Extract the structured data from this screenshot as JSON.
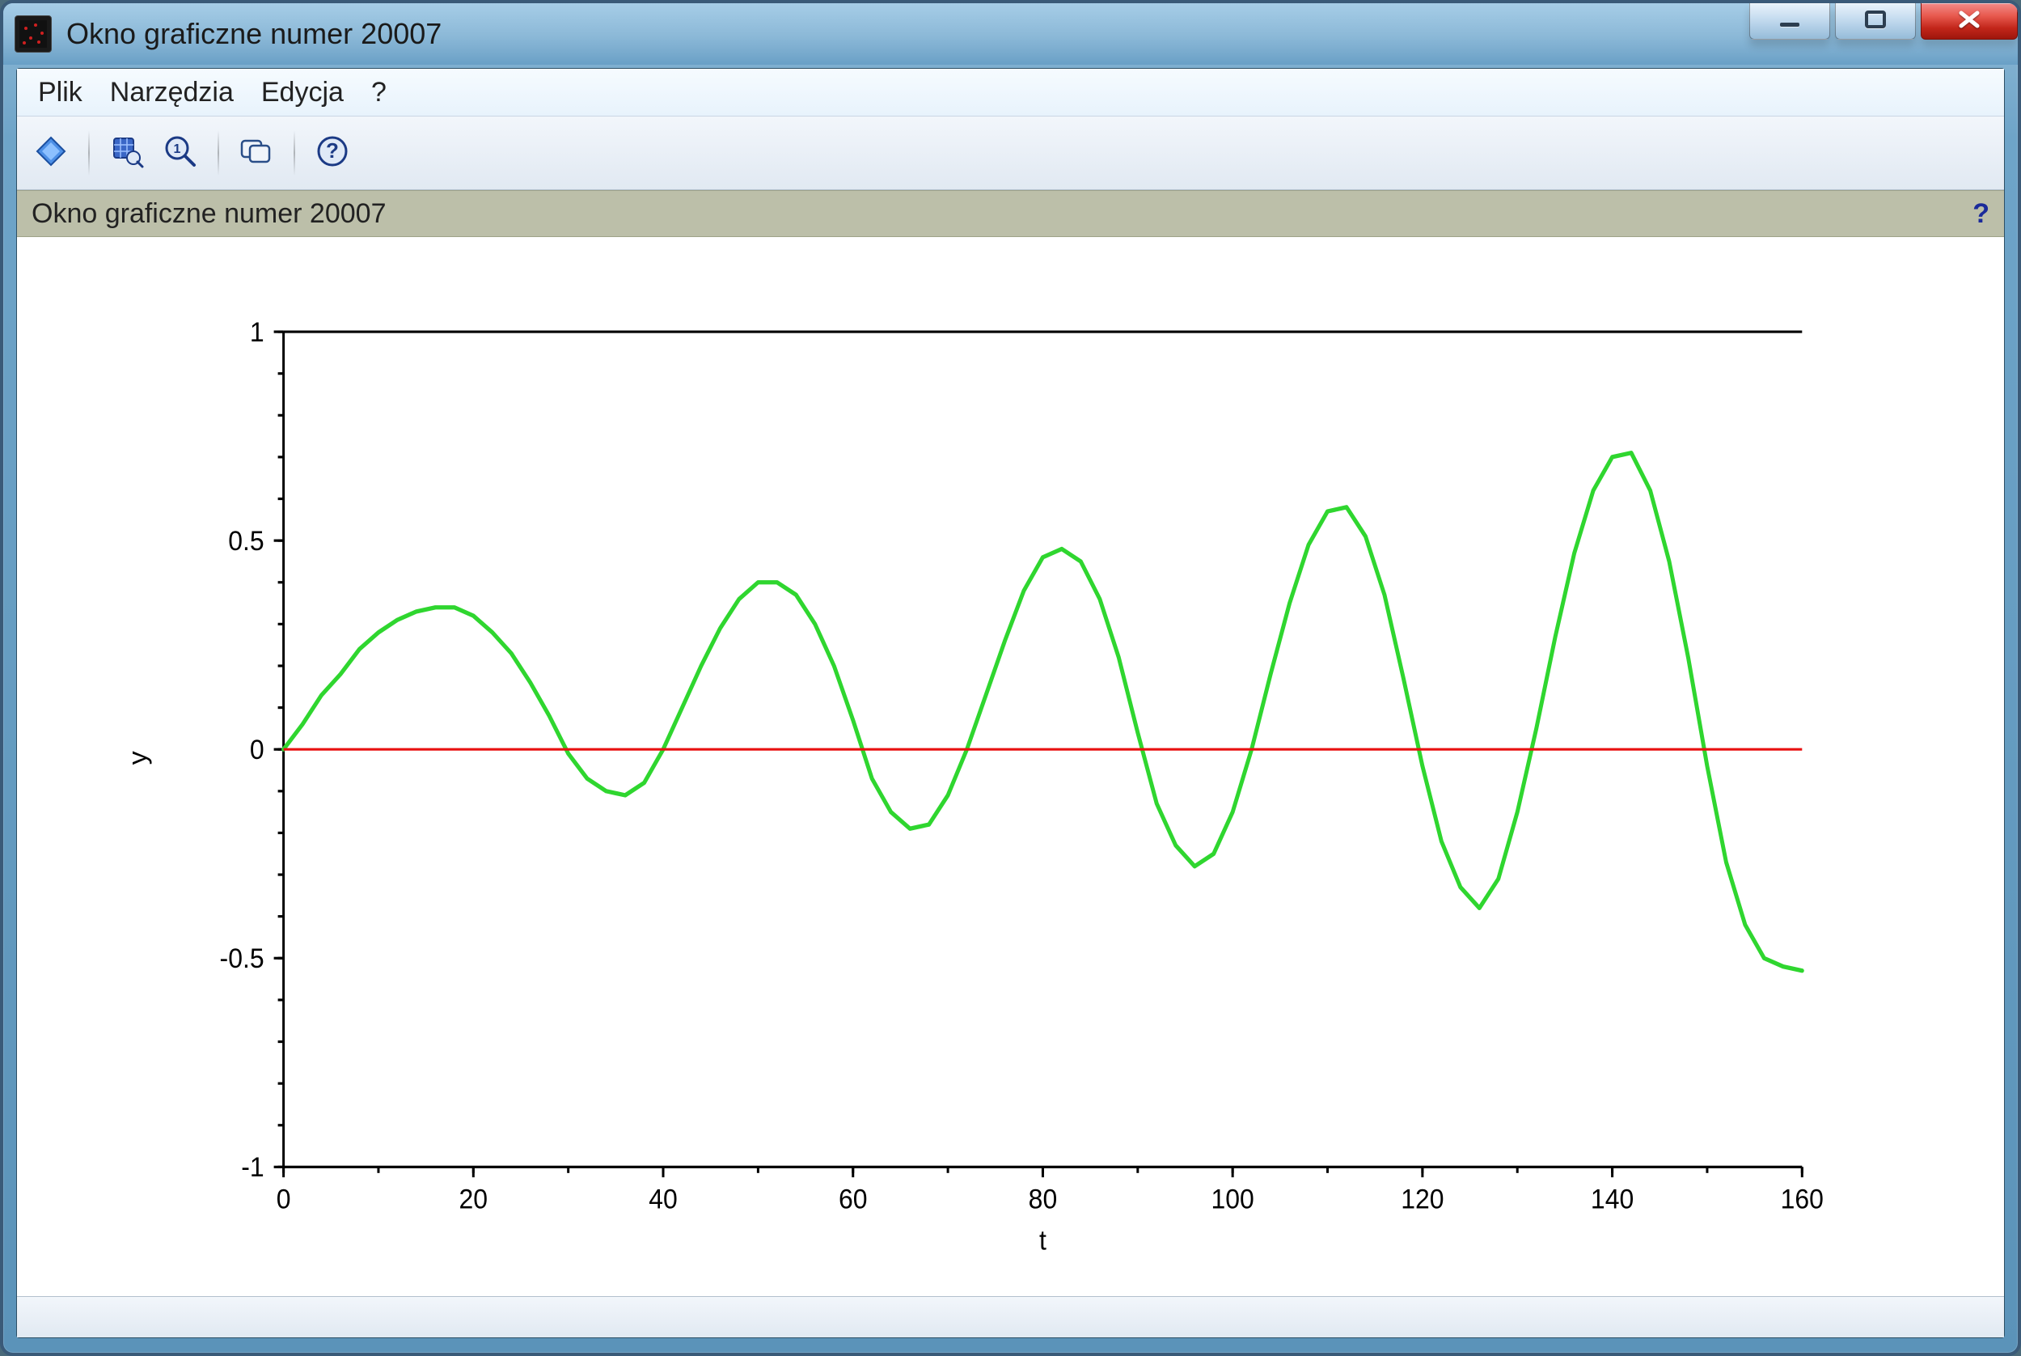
{
  "window": {
    "title": "Okno graficzne numer 20007"
  },
  "menu": {
    "items": [
      "Plik",
      "Narzędzia",
      "Edycja",
      "?"
    ]
  },
  "toolbar": {
    "rotate_label": "Rotate",
    "zoom_area_label": "Zoom area",
    "zoom_reset_label": "Reset zoom",
    "copy_label": "Copy",
    "help_label": "Help"
  },
  "infobar": {
    "text": "Okno graficzne numer 20007",
    "help_glyph": "?"
  },
  "chart_data": {
    "type": "line",
    "xlabel": "t",
    "ylabel": "y",
    "xlim": [
      0,
      160
    ],
    "ylim": [
      -1,
      1
    ],
    "xticks": [
      0,
      20,
      40,
      60,
      80,
      100,
      120,
      140,
      160
    ],
    "yticks": [
      -1,
      -0.5,
      0,
      0.5,
      1
    ],
    "series": [
      {
        "name": "green",
        "color": "#2fd62f",
        "x": [
          0,
          2,
          4,
          6,
          8,
          10,
          12,
          14,
          16,
          18,
          20,
          22,
          24,
          26,
          28,
          30,
          32,
          34,
          36,
          38,
          40,
          42,
          44,
          46,
          48,
          50,
          52,
          54,
          56,
          58,
          60,
          62,
          64,
          66,
          68,
          70,
          72,
          74,
          76,
          78,
          80,
          82,
          84,
          86,
          88,
          90,
          92,
          94,
          96,
          98,
          100,
          102,
          104,
          106,
          108,
          110,
          112,
          114,
          116,
          118,
          120,
          122,
          124,
          126,
          128,
          130,
          132,
          134,
          136,
          138,
          140,
          142,
          144,
          146,
          148,
          150,
          152,
          154,
          156,
          158,
          160
        ],
        "values": [
          0.0,
          0.06,
          0.13,
          0.18,
          0.24,
          0.28,
          0.31,
          0.33,
          0.34,
          0.34,
          0.32,
          0.28,
          0.23,
          0.16,
          0.08,
          -0.01,
          -0.07,
          -0.1,
          -0.11,
          -0.08,
          0.0,
          0.1,
          0.2,
          0.29,
          0.36,
          0.4,
          0.4,
          0.37,
          0.3,
          0.2,
          0.07,
          -0.07,
          -0.15,
          -0.19,
          -0.18,
          -0.11,
          0.0,
          0.13,
          0.26,
          0.38,
          0.46,
          0.48,
          0.45,
          0.36,
          0.22,
          0.04,
          -0.13,
          -0.23,
          -0.28,
          -0.25,
          -0.15,
          0.0,
          0.18,
          0.35,
          0.49,
          0.57,
          0.58,
          0.51,
          0.37,
          0.17,
          -0.04,
          -0.22,
          -0.33,
          -0.38,
          -0.31,
          -0.15,
          0.05,
          0.27,
          0.47,
          0.62,
          0.7,
          0.71,
          0.62,
          0.45,
          0.22,
          -0.04,
          -0.27,
          -0.42,
          -0.5,
          -0.52,
          -0.53
        ]
      },
      {
        "name": "red_zero_line",
        "color": "#e81010",
        "x": [
          0,
          160
        ],
        "values": [
          0,
          0
        ]
      },
      {
        "name": "black_top_line",
        "color": "#000000",
        "x": [
          0,
          160
        ],
        "values": [
          1,
          1
        ]
      }
    ]
  }
}
